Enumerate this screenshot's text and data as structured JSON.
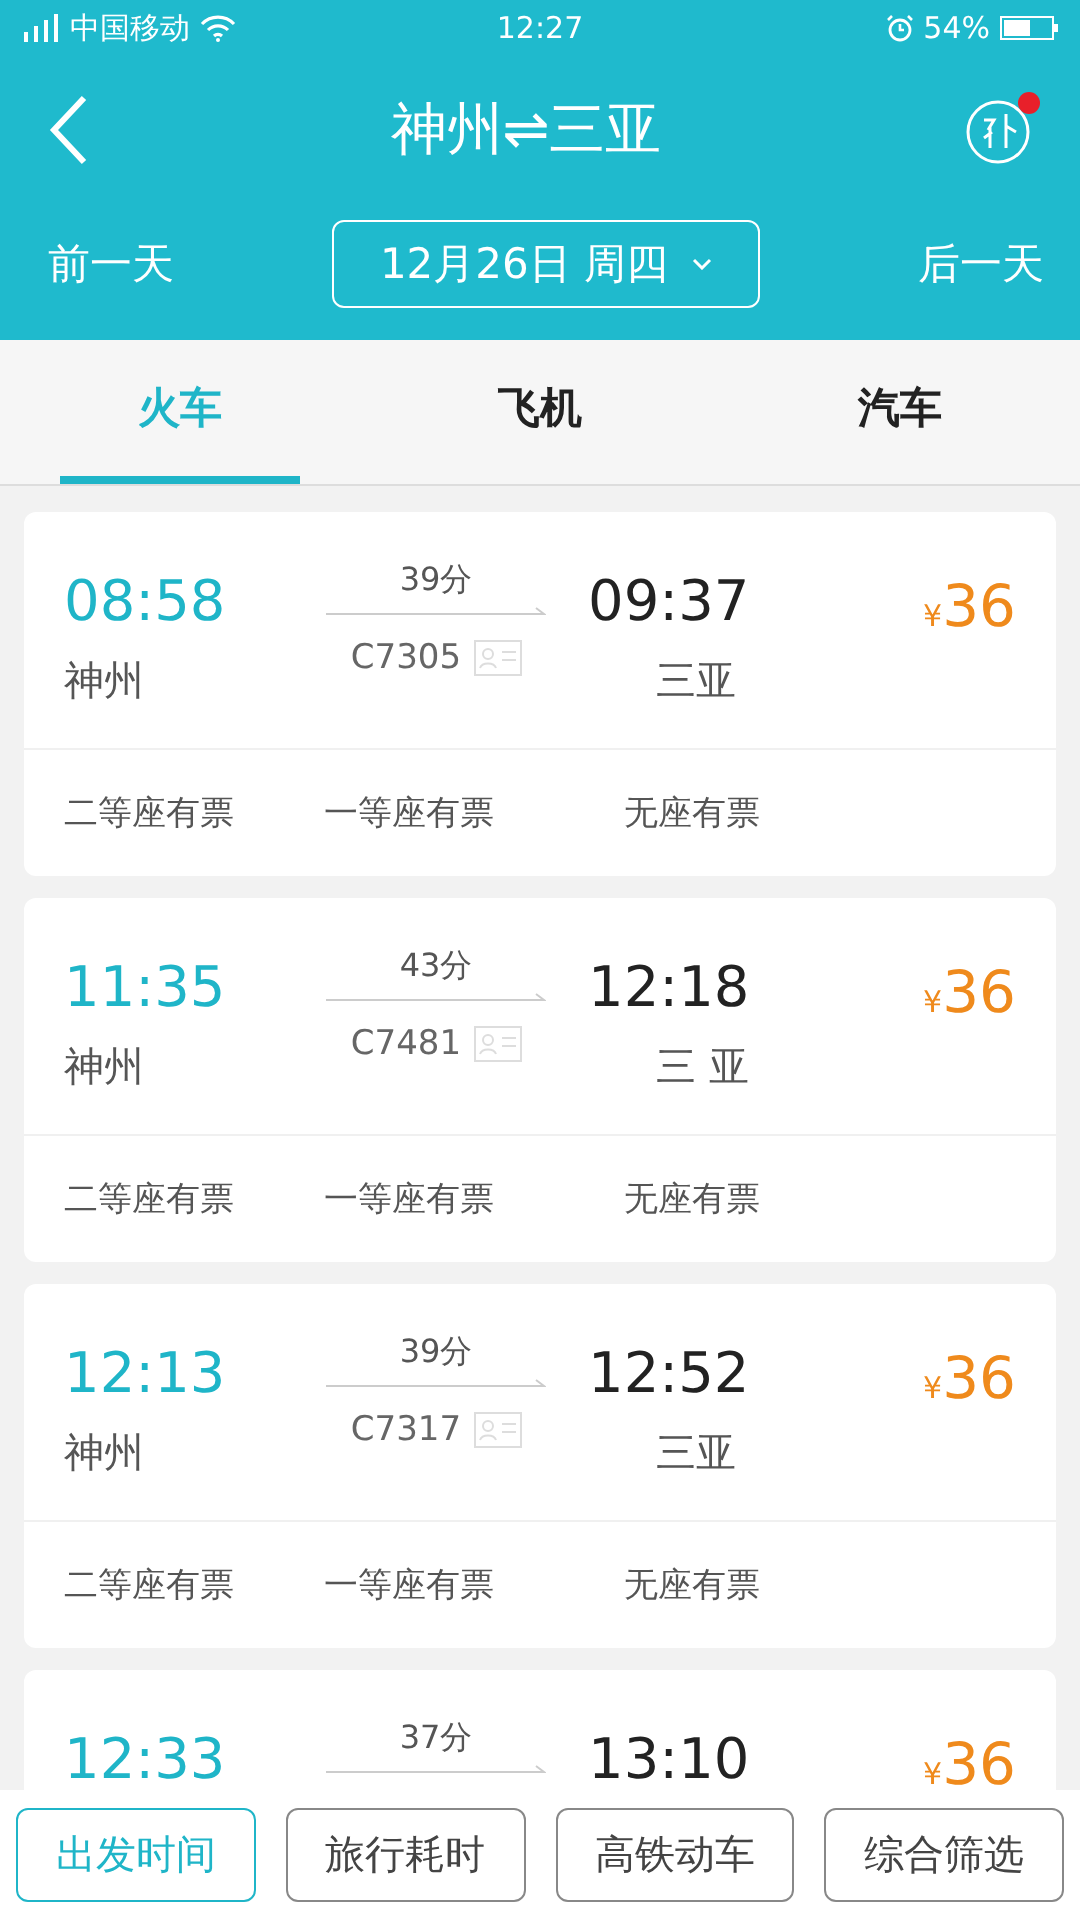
{
  "status_bar": {
    "carrier": "中国移动",
    "time": "12:27",
    "battery": "54%"
  },
  "header": {
    "title": "神州⇌三亚",
    "date": "12月26日 周四",
    "prev": "前一天",
    "next": "后一天",
    "has_notice": true
  },
  "tabs": [
    {
      "label": "火车",
      "selected": true
    },
    {
      "label": "飞机",
      "selected": false
    },
    {
      "label": "汽车",
      "selected": false
    }
  ],
  "trains": [
    {
      "depart": "08:58",
      "duration": "39分",
      "arrive": "09:37",
      "price": "36",
      "from": "神州",
      "train_no": "C7305",
      "to": "三亚",
      "seats": [
        "二等座有票",
        "一等座有票",
        "无座有票"
      ]
    },
    {
      "depart": "11:35",
      "duration": "43分",
      "arrive": "12:18",
      "price": "36",
      "from": "神州",
      "train_no": "C7481",
      "to": "三 亚",
      "seats": [
        "二等座有票",
        "一等座有票",
        "无座有票"
      ]
    },
    {
      "depart": "12:13",
      "duration": "39分",
      "arrive": "12:52",
      "price": "36",
      "from": "神州",
      "train_no": "C7317",
      "to": "三亚",
      "seats": [
        "二等座有票",
        "一等座有票",
        "无座有票"
      ]
    },
    {
      "depart": "12:33",
      "duration": "37分",
      "arrive": "13:10",
      "price": "36"
    }
  ],
  "currency": "¥",
  "filters": [
    {
      "label": "出发时间",
      "selected": true
    },
    {
      "label": "旅行耗时",
      "selected": false
    },
    {
      "label": "高铁动车",
      "selected": false
    },
    {
      "label": "综合筛选",
      "selected": false
    }
  ]
}
